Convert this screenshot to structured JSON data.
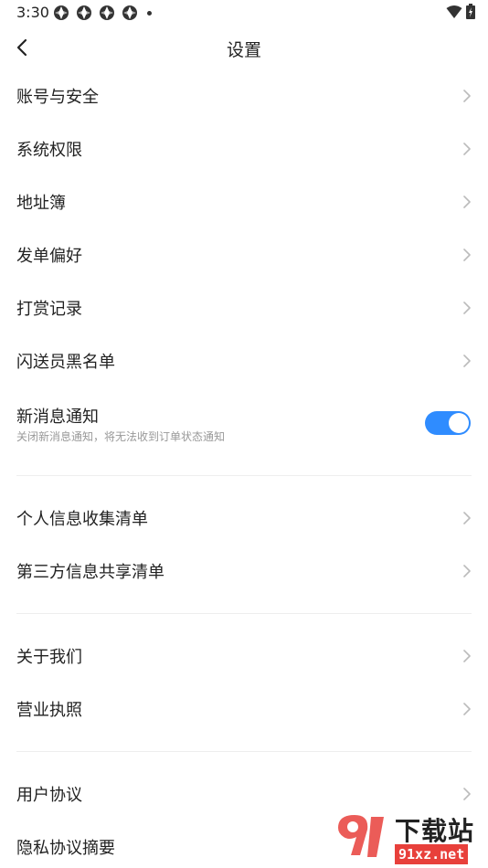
{
  "status_bar": {
    "time": "3:30"
  },
  "header": {
    "title": "设置"
  },
  "menu": {
    "account_security": "账号与安全",
    "system_permissions": "系统权限",
    "address_book": "地址簿",
    "order_preferences": "发单偏好",
    "tip_records": "打赏记录",
    "courier_blacklist": "闪送员黑名单",
    "new_message_notification": "新消息通知",
    "new_message_notification_desc": "关闭新消息通知，将无法收到订单状态通知",
    "personal_info_list": "个人信息收集清单",
    "third_party_sharing_list": "第三方信息共享清单",
    "about_us": "关于我们",
    "business_license": "营业执照",
    "user_agreement": "用户协议",
    "privacy_summary": "隐私协议摘要"
  },
  "toggles": {
    "new_message_notification_on": true
  },
  "watermark": {
    "title": "下载站",
    "url": "91xz.net"
  },
  "colors": {
    "accent": "#2f8cff",
    "watermark_red": "#e8403b"
  }
}
